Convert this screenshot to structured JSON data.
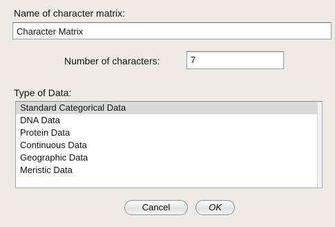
{
  "matrix_name": {
    "label": "Name of character matrix:",
    "value": "Character Matrix"
  },
  "num_characters": {
    "label": "Number of characters:",
    "value": "7"
  },
  "data_type": {
    "label": "Type of Data:",
    "selected_index": 0,
    "options": [
      "Standard Categorical Data",
      "DNA Data",
      "Protein Data",
      "Continuous Data",
      "Geographic Data",
      "Meristic Data"
    ]
  },
  "buttons": {
    "cancel_label": "Cancel",
    "ok_label": "OK"
  },
  "colors": {
    "background": "#efebe4",
    "selection": "#d9d9d9"
  }
}
